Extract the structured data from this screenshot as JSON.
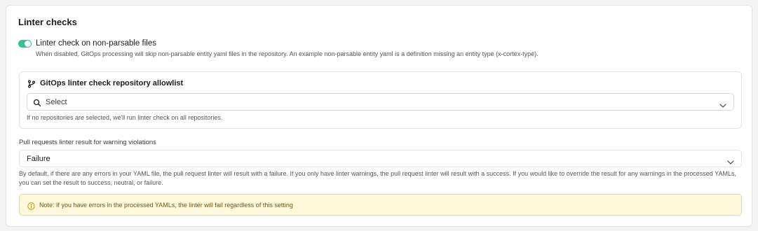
{
  "section": {
    "title": "Linter checks"
  },
  "toggle": {
    "label": "Linter check on non-parsable files",
    "description": "When disabled, GitOps processing will skip non-parsable entity yaml files in the repository. An example non-parsable entity yaml is a definition missing an entity type (x-cortex-type).",
    "enabled": true,
    "color": "#3cc08a"
  },
  "allowlist": {
    "title": "GitOps linter check repository allowlist",
    "icon": "git-branch-icon",
    "select_placeholder": "Select",
    "help": "If no repositories are selected, we'll run linter check on all repositories."
  },
  "warnings": {
    "label": "Pull requests linter result for warning violations",
    "value": "Failure",
    "description": "By default, if there are any errors in your YAML file, the pull request linter will result with a failure. If you only have linter warnings, the pull request linter will result with a success. If you would like to override the result for any warnings in the processed YAMLs, you can set the result to success, neutral, or failure."
  },
  "note": {
    "icon": "info-icon",
    "text": "Note: If you have errors in the processed YAMLs, the linter will fail regardless of this setting",
    "background": "#fdf8d9",
    "border": "#efd98a",
    "text_color": "#7a5410"
  }
}
